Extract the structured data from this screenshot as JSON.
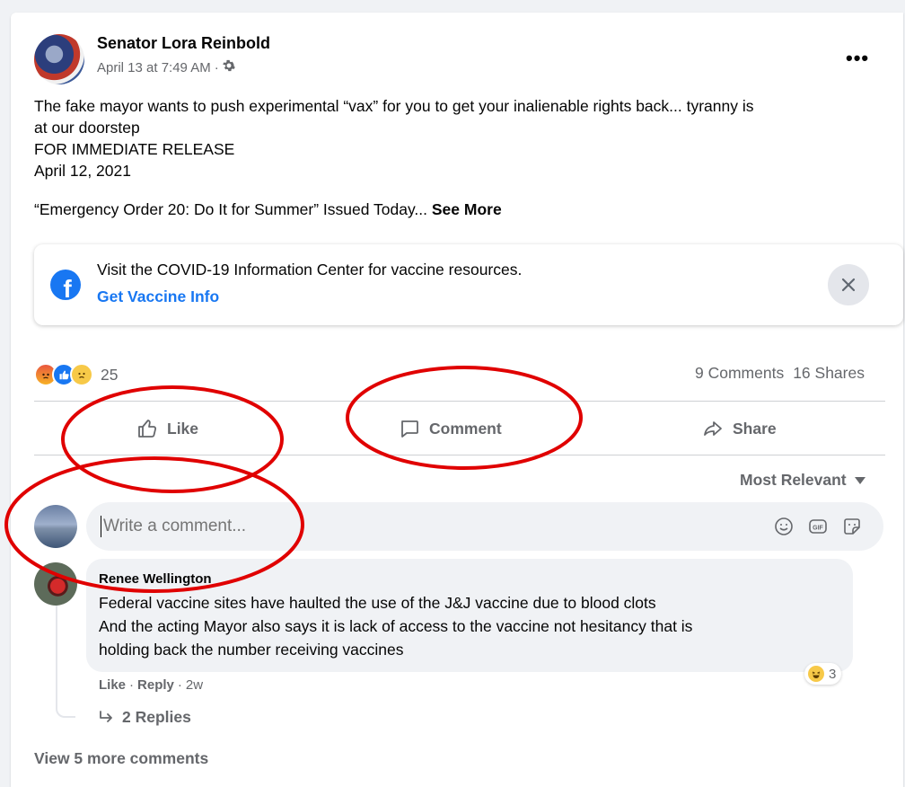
{
  "post": {
    "author": "Senator Lora Reinbold",
    "date": "April 13 at 7:49 AM",
    "meta_separator": "·",
    "privacy_icon": "gear-icon",
    "more_label": "•••",
    "text_lines": [
      "The fake mayor wants to push experimental “vax” for you to get your inalienable rights back... tyranny is",
      "at our doorstep",
      "FOR IMMEDIATE RELEASE",
      "April 12, 2021"
    ],
    "summary": "“Emergency Order 20: Do It for Summer” Issued Today...",
    "see_more": "See More"
  },
  "info_box": {
    "text": "Visit the COVID-19 Information Center for vaccine resources.",
    "link": "Get Vaccine Info",
    "logo_letter": "f"
  },
  "reactions": {
    "icons": [
      "angry",
      "like",
      "sad"
    ],
    "count": "25"
  },
  "stats": {
    "comments": "9 Comments",
    "shares": "16 Shares"
  },
  "actions": {
    "like": "Like",
    "comment": "Comment",
    "share": "Share"
  },
  "sort": {
    "label": "Most Relevant"
  },
  "comment_input": {
    "placeholder": "Write a comment..."
  },
  "comment": {
    "author": "Renee Wellington",
    "lines": [
      "Federal vaccine sites have haulted the use of the J&J vaccine due to blood clots",
      "And the acting Mayor also says it is lack of access to the vaccine not hesitancy that is",
      "holding back the number receiving vaccines"
    ],
    "reaction_count": "3",
    "like": "Like",
    "dot": "·",
    "reply": "Reply",
    "age": "2w",
    "replies": "2 Replies"
  },
  "view_more": "View 5 more comments",
  "colors": {
    "facebook_blue": "#1877f2",
    "secondary_text": "#65676b",
    "annotation_red": "#e00000"
  }
}
